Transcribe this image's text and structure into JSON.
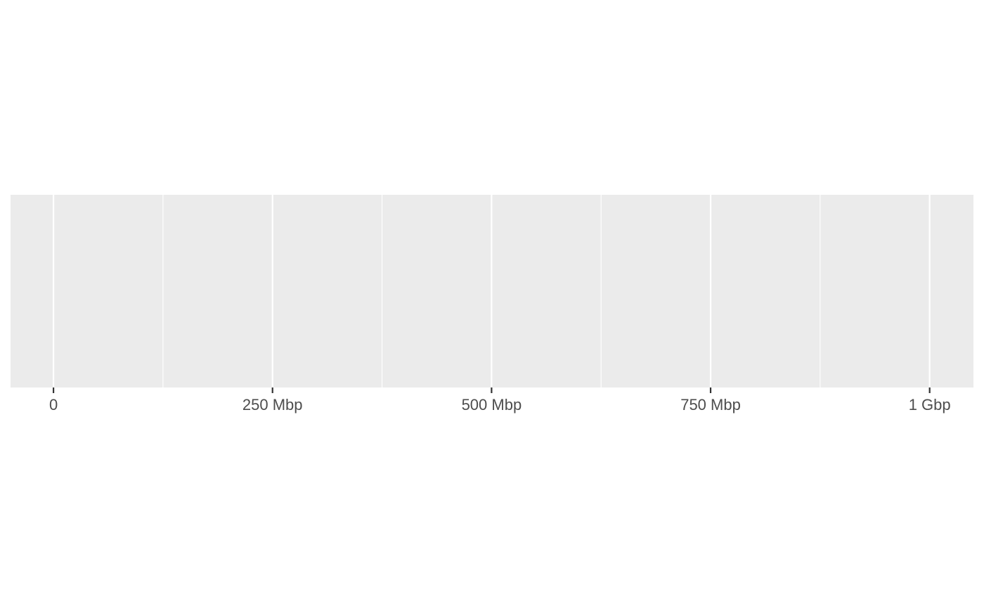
{
  "chart_data": {
    "type": "scatter",
    "title": "",
    "xlabel": "",
    "ylabel": "",
    "xlim": [
      -49000000,
      1050000000
    ],
    "x_ticks_major": [
      0,
      250000000,
      500000000,
      750000000,
      1000000000
    ],
    "x_ticks_minor": [
      125000000,
      375000000,
      625000000,
      875000000
    ],
    "x_tick_labels": [
      "0",
      "250 Mbp",
      "500 Mbp",
      "750 Mbp",
      "1 Gbp"
    ],
    "series": [],
    "grid": true,
    "y_axis_shown": false,
    "legend": "none"
  },
  "colors": {
    "panel_background": "#ebebeb",
    "grid_line": "#ffffff",
    "axis_tick": "#333333",
    "tick_label": "#4d4d4d"
  }
}
